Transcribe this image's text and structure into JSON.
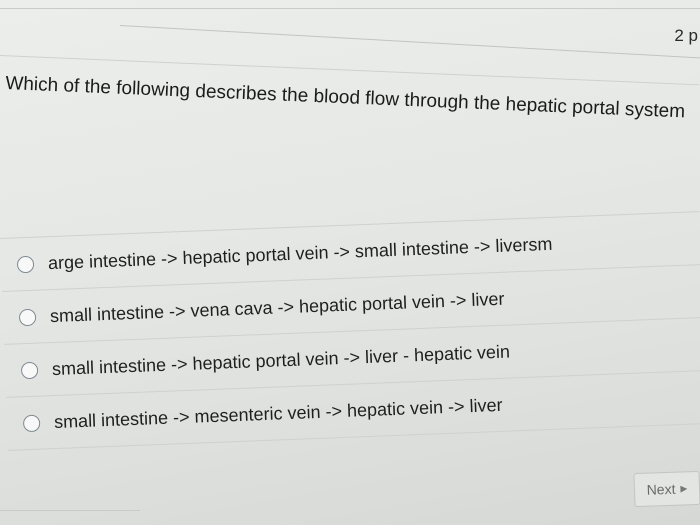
{
  "points_label": "2 p",
  "question": "Which of the following describes the blood flow through the hepatic portal system",
  "options": [
    "arge intestine -> hepatic portal vein -> small intestine -> liversm",
    "small intestine -> vena cava -> hepatic portal vein -> liver",
    "small intestine -> hepatic portal vein -> liver - hepatic vein",
    "small intestine -> mesenteric vein -> hepatic vein -> liver"
  ],
  "navigation": {
    "next_label": "Next",
    "next_icon": "triangle-right-icon"
  }
}
